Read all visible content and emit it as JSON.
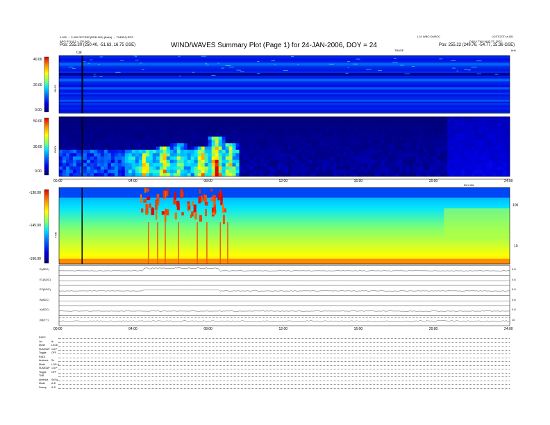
{
  "header": {
    "title": "WIND/WAVES Summary Plot (Page 1) for 24-JAN-2006, DOY = 24",
    "left_line1": "4.030 → 3.000 RPCSRF(RDB.000) (ffa6h) → THEIRQ.RPS",
    "left_line2": "ARQ.R10.8.2 = 130.000",
    "left_line3": "Pos:   255.30 (250.40, -51.63, 16.75 GSE)",
    "right_line0": "1.10 WBO DUROC",
    "right_line0b": "LOSTOOT=a.001",
    "right_line1": "DAILY THU AUG 23, 2007",
    "right_line2": "Pos:   255.22 (249.76, -54.77, 15.36 GSE)",
    "mid_label": "TBUSE",
    "right_label": "kHz"
  },
  "panels": {
    "rad2": {
      "name": "RAD2",
      "ticks": [
        "40.00",
        "20.00",
        "0.00"
      ],
      "marker": "Cal"
    },
    "rad1": {
      "name": "RAD1",
      "ticks": [
        "50.00",
        "30.00",
        "0.00"
      ]
    },
    "tnr": {
      "name": "TNR",
      "ticks": [
        "-130.00",
        "-145.00",
        "-160.00"
      ],
      "right_ticks": [
        "100",
        "10"
      ],
      "label_right": "BXX.tBL"
    },
    "time_axis_top": [
      "00:00",
      "04:00",
      "08:00",
      "12:00",
      "16:00",
      "20:00",
      "24:00"
    ],
    "time_axis_bottom": [
      "00:00",
      "04:00",
      "08:00",
      "12:00",
      "16:00",
      "20:00",
      "24:00"
    ]
  },
  "strips": [
    {
      "label": "E(ADC)",
      "right": "0.8"
    },
    {
      "label": "E1(ADC)",
      "right": "0.8"
    },
    {
      "label": "E2(ADC)",
      "right": "0.8"
    },
    {
      "label": "B(ADC)",
      "right": "0.8"
    },
    {
      "label": "X(ADC)",
      "right": "0.8"
    },
    {
      "label": "(B)(TT)",
      "right": "10"
    }
  ],
  "footer": {
    "sections": [
      {
        "title": "RAD2",
        "rows": [
          [
            "Lst",
            "lb"
          ],
          [
            "Mode",
            "LIN-8"
          ],
          [
            "SUMGAP",
            "1.6:P"
          ],
          [
            "Toggle",
            "OFF"
          ]
        ]
      },
      {
        "title": "RAD1",
        "rows": [
          [
            "Antenna",
            "Sx"
          ],
          [
            "Mode",
            "LOG-4"
          ],
          [
            "SUMGAP",
            "1.6:P"
          ],
          [
            "Toggle",
            "OFF"
          ]
        ]
      },
      {
        "title": "TNR",
        "rows": [
          [
            "Antenna",
            "Sx/Sy"
          ],
          [
            "Mode",
            "A-D"
          ],
          [
            "Sweep",
            "A-D"
          ]
        ]
      }
    ]
  },
  "chart_data": {
    "type": "heatmap",
    "title": "WIND/WAVES Summary Plot (Page 1) for 24-JAN-2006, DOY = 24",
    "x_axis": {
      "label": "",
      "range": [
        0,
        24
      ],
      "ticks": [
        "00:00",
        "04:00",
        "08:00",
        "12:00",
        "16:00",
        "20:00",
        "24:00"
      ]
    },
    "panels": [
      {
        "name": "RAD2",
        "ylim": [
          0,
          40
        ],
        "colorbar": "rainbow",
        "background_level": 0.18,
        "bright_lines_frac": [
          0.14,
          0.3,
          0.42,
          0.55,
          0.78
        ]
      },
      {
        "name": "RAD1",
        "ylim": [
          0,
          50
        ],
        "colorbar": "rainbow",
        "bursts": [
          [
            4.5,
            0.82,
            0.7
          ],
          [
            5.5,
            0.78,
            0.75
          ],
          [
            6.3,
            0.72,
            0.6
          ],
          [
            7.5,
            0.75,
            0.8
          ],
          [
            8.3,
            0.62,
            0.95
          ],
          [
            9.0,
            0.74,
            0.7
          ]
        ]
      },
      {
        "name": "TNR",
        "ylim": [
          -160,
          -130
        ],
        "colorbar": "rainbow",
        "bursts_x": [
          4.5,
          5.0,
          5.6,
          6.3,
          7.0,
          7.6,
          8.2,
          8.6
        ]
      }
    ],
    "strip_series": [
      "E(ADC)",
      "E1(ADC)",
      "E2(ADC)",
      "B(ADC)",
      "X(ADC)",
      "(B)(TT)"
    ],
    "colors": {
      "cold": "#0000a0",
      "warm": "#ff2000"
    }
  }
}
